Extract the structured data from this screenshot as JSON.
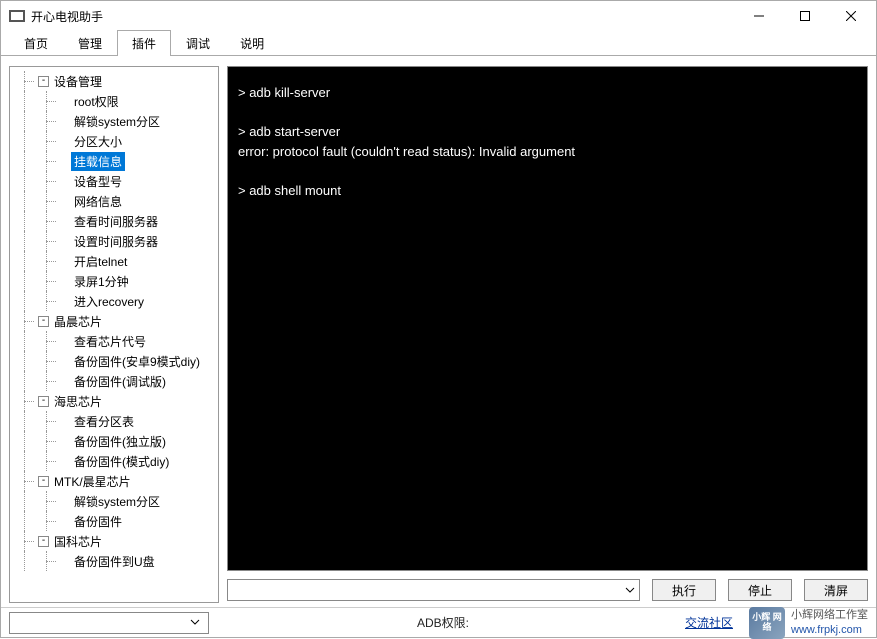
{
  "window": {
    "title": "开心电视助手"
  },
  "tabs": [
    "首页",
    "管理",
    "插件",
    "调试",
    "说明"
  ],
  "active_tab_index": 2,
  "tree": [
    {
      "label": "设备管理",
      "children": [
        "root权限",
        "解锁system分区",
        "分区大小",
        "挂载信息",
        "设备型号",
        "网络信息",
        "查看时间服务器",
        "设置时间服务器",
        "开启telnet",
        "录屏1分钟",
        "进入recovery"
      ]
    },
    {
      "label": "晶晨芯片",
      "children": [
        "查看芯片代号",
        "备份固件(安卓9模式diy)",
        "备份固件(调试版)"
      ]
    },
    {
      "label": "海思芯片",
      "children": [
        "查看分区表",
        "备份固件(独立版)",
        "备份固件(模式diy)"
      ]
    },
    {
      "label": "MTK/晨星芯片",
      "children": [
        "解锁system分区",
        "备份固件"
      ]
    },
    {
      "label": "国科芯片",
      "children": [
        "备份固件到U盘"
      ]
    }
  ],
  "selected_path": "设备管理/挂载信息",
  "console_lines": [
    "> adb kill-server",
    "",
    "> adb start-server",
    "error: protocol fault (couldn't read status): Invalid argument",
    "",
    "> adb shell mount"
  ],
  "cmd_input": {
    "value": "",
    "placeholder": ""
  },
  "buttons": {
    "run": "执行",
    "stop": "停止",
    "clear": "清屏"
  },
  "status": {
    "adb_label": "ADB权限:",
    "community": "交流社区",
    "brand_line1": "小辉网络工作室",
    "brand_line2": "www.frpkj.com",
    "logo_text": "小辉\n网络"
  }
}
